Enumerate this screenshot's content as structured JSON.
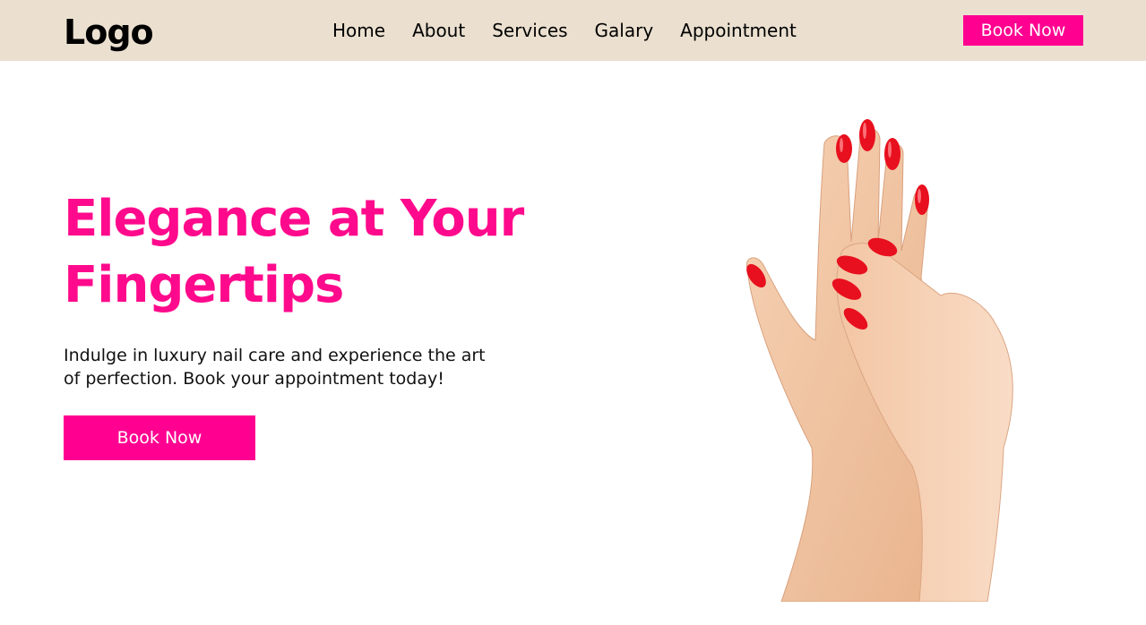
{
  "header": {
    "logo": "Logo",
    "nav": [
      {
        "label": "Home"
      },
      {
        "label": "About"
      },
      {
        "label": "Services"
      },
      {
        "label": "Galary"
      },
      {
        "label": "Appointment"
      }
    ],
    "cta_label": "Book Now"
  },
  "hero": {
    "title": "Elegance at Your Fingertips",
    "subtitle": "Indulge in luxury nail care and experience the art of perfection. Book your appointment today!",
    "cta_label": "Book Now",
    "image": "hands-with-red-nails"
  },
  "colors": {
    "header_bg": "#ebe0d0",
    "accent": "#ff0090",
    "nail_red": "#e8101e"
  }
}
